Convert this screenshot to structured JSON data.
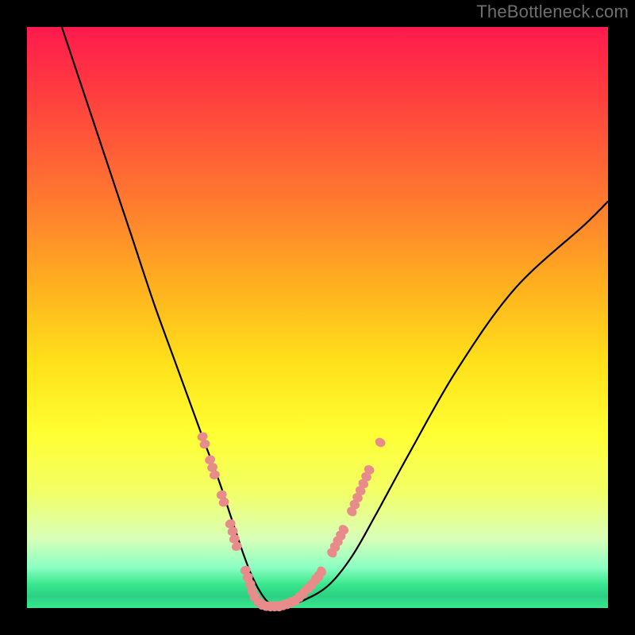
{
  "watermark": "TheBottleneck.com",
  "colors": {
    "curve_stroke": "#000000",
    "marker_fill": "#e88b8b",
    "background_frame": "#000000"
  },
  "chart_data": {
    "type": "line",
    "title": "",
    "xlabel": "",
    "ylabel": "",
    "xlim": [
      0,
      100
    ],
    "ylim": [
      0,
      100
    ],
    "series": [
      {
        "name": "bottleneck-curve",
        "x": [
          6,
          10,
          14,
          18,
          22,
          26,
          30,
          33,
          35,
          37,
          38.5,
          40,
          41.5,
          43,
          45,
          48,
          52,
          56,
          60,
          66,
          74,
          84,
          96,
          100
        ],
        "y": [
          100,
          88,
          76,
          64,
          52,
          41,
          30,
          22,
          16,
          10,
          6,
          3,
          1,
          0.5,
          0.5,
          1.5,
          4,
          9,
          16,
          27,
          41,
          55,
          66,
          70
        ]
      }
    ],
    "markers": {
      "name": "highlighted-points",
      "points": [
        {
          "x": 30.2,
          "y": 29.5
        },
        {
          "x": 30.6,
          "y": 28.2
        },
        {
          "x": 31.5,
          "y": 25.5
        },
        {
          "x": 31.9,
          "y": 24.2
        },
        {
          "x": 32.3,
          "y": 22.9
        },
        {
          "x": 33.5,
          "y": 19.5
        },
        {
          "x": 33.9,
          "y": 18.2
        },
        {
          "x": 35.0,
          "y": 14.5
        },
        {
          "x": 35.4,
          "y": 13.2
        },
        {
          "x": 35.7,
          "y": 11.9
        },
        {
          "x": 36.1,
          "y": 10.6
        },
        {
          "x": 37.6,
          "y": 6.5
        },
        {
          "x": 38.0,
          "y": 5.3
        },
        {
          "x": 38.4,
          "y": 4.1
        },
        {
          "x": 38.8,
          "y": 2.9
        },
        {
          "x": 39.2,
          "y": 1.9
        },
        {
          "x": 39.9,
          "y": 1.0
        },
        {
          "x": 40.6,
          "y": 0.5
        },
        {
          "x": 41.3,
          "y": 0.3
        },
        {
          "x": 42.0,
          "y": 0.3
        },
        {
          "x": 42.7,
          "y": 0.3
        },
        {
          "x": 43.4,
          "y": 0.3
        },
        {
          "x": 44.1,
          "y": 0.5
        },
        {
          "x": 44.8,
          "y": 0.7
        },
        {
          "x": 45.5,
          "y": 1.0
        },
        {
          "x": 46.2,
          "y": 1.3
        },
        {
          "x": 46.9,
          "y": 1.9
        },
        {
          "x": 47.6,
          "y": 2.6
        },
        {
          "x": 48.3,
          "y": 3.3
        },
        {
          "x": 49.0,
          "y": 4.0
        },
        {
          "x": 49.7,
          "y": 4.9
        },
        {
          "x": 50.2,
          "y": 5.5
        },
        {
          "x": 50.7,
          "y": 6.3
        },
        {
          "x": 52.5,
          "y": 9.5
        },
        {
          "x": 53.0,
          "y": 10.5
        },
        {
          "x": 53.5,
          "y": 11.5
        },
        {
          "x": 54.0,
          "y": 12.5
        },
        {
          "x": 54.5,
          "y": 13.5
        },
        {
          "x": 55.9,
          "y": 16.6
        },
        {
          "x": 56.4,
          "y": 17.8
        },
        {
          "x": 56.9,
          "y": 19.0
        },
        {
          "x": 57.4,
          "y": 20.2
        },
        {
          "x": 57.9,
          "y": 21.4
        },
        {
          "x": 58.4,
          "y": 22.6
        },
        {
          "x": 58.9,
          "y": 23.8
        },
        {
          "x": 60.8,
          "y": 28.5
        }
      ]
    },
    "gradient_stops": [
      {
        "pos": 0.0,
        "color": "#ff1a4d"
      },
      {
        "pos": 0.12,
        "color": "#ff3f3f"
      },
      {
        "pos": 0.3,
        "color": "#ff7a2f"
      },
      {
        "pos": 0.45,
        "color": "#ffb21f"
      },
      {
        "pos": 0.58,
        "color": "#ffe11a"
      },
      {
        "pos": 0.7,
        "color": "#ffff33"
      },
      {
        "pos": 0.8,
        "color": "#f2ff66"
      },
      {
        "pos": 0.88,
        "color": "#d9ffb8"
      },
      {
        "pos": 0.93,
        "color": "#8bffc2"
      },
      {
        "pos": 0.96,
        "color": "#39e68c"
      },
      {
        "pos": 0.98,
        "color": "#2bd184"
      },
      {
        "pos": 1.0,
        "color": "#39e68c"
      }
    ]
  }
}
